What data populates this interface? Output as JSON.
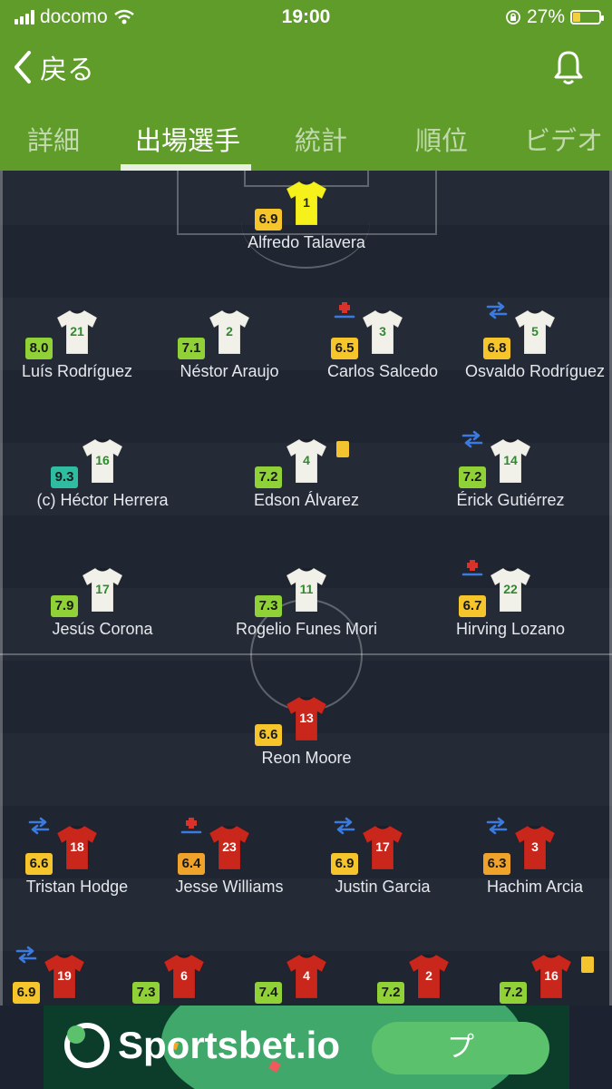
{
  "status_bar": {
    "carrier": "docomo",
    "time": "19:00",
    "battery": "27%",
    "battery_level": 0.27
  },
  "nav": {
    "back_label": "戻る"
  },
  "tabs": [
    {
      "label": "詳細"
    },
    {
      "label": "出場選手",
      "active": true
    },
    {
      "label": "統計"
    },
    {
      "label": "順位"
    },
    {
      "label": "ビデオ"
    }
  ],
  "home_players": [
    {
      "name": "Alfredo Talavera",
      "number": "1",
      "rating": "6.9",
      "kit": "keeper"
    },
    {
      "name": "Luís Rodríguez",
      "number": "21",
      "rating": "8.0"
    },
    {
      "name": "Néstor Araujo",
      "number": "2",
      "rating": "7.1"
    },
    {
      "name": "Carlos Salcedo",
      "number": "3",
      "rating": "6.5",
      "badge": "injury"
    },
    {
      "name": "Osvaldo Rodríguez",
      "number": "5",
      "rating": "6.8",
      "badge": "substitution"
    },
    {
      "name": "(c) Héctor Herrera",
      "number": "16",
      "rating": "9.3"
    },
    {
      "name": "Edson Álvarez",
      "number": "4",
      "rating": "7.2",
      "card": "yellow"
    },
    {
      "name": "Érick Gutiérrez",
      "number": "14",
      "rating": "7.2",
      "badge": "substitution"
    },
    {
      "name": "Jesús Corona",
      "number": "17",
      "rating": "7.9"
    },
    {
      "name": "Rogelio Funes Mori",
      "number": "11",
      "rating": "7.3"
    },
    {
      "name": "Hirving Lozano",
      "number": "22",
      "rating": "6.7",
      "badge": "injury"
    }
  ],
  "away_players": [
    {
      "name": "Reon Moore",
      "number": "13",
      "rating": "6.6"
    },
    {
      "name": "Tristan Hodge",
      "number": "18",
      "rating": "6.6",
      "badge": "substitution"
    },
    {
      "name": "Jesse Williams",
      "number": "23",
      "rating": "6.4",
      "badge": "injury"
    },
    {
      "name": "Justin Garcia",
      "number": "17",
      "rating": "6.9",
      "badge": "substitution"
    },
    {
      "name": "Hachim Arcia",
      "number": "3",
      "rating": "6.3",
      "badge": "substitution"
    },
    {
      "name": "",
      "number": "19",
      "rating": "6.9",
      "badge": "substitution"
    },
    {
      "name": "",
      "number": "6",
      "rating": "7.3"
    },
    {
      "name": "",
      "number": "4",
      "rating": "7.4"
    },
    {
      "name": "",
      "number": "2",
      "rating": "7.2"
    },
    {
      "name": "",
      "number": "16",
      "rating": "7.2",
      "card": "yellow"
    }
  ],
  "ad": {
    "brand": "Sportsbet.io",
    "button_label": "プ"
  },
  "colors": {
    "header_green": "#5f9c2a",
    "pitch": "#242b37",
    "home_kit": "#f1f1ea",
    "home_number": "#2f8a2f",
    "keeper_kit": "#f6f01b",
    "away_kit": "#c9261c",
    "rating_high": "#2fbda2",
    "rating_good": "#8fd136",
    "rating_mid": "#f5c52b",
    "rating_low": "#f0a32b",
    "sub_arrows": "#3b7be0",
    "injury_cross": "#d8322a"
  }
}
